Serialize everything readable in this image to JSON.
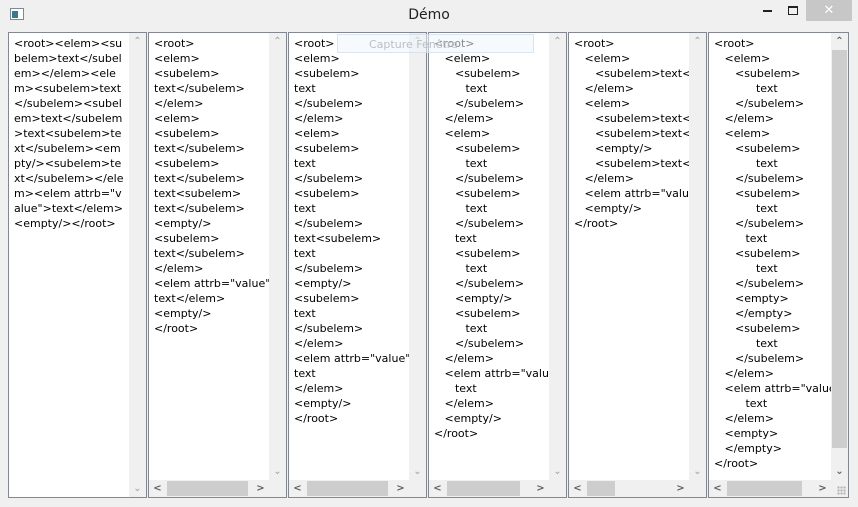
{
  "window": {
    "title": "Démo",
    "minimize_icon": "minimize-icon",
    "maximize_icon": "maximize-icon",
    "close_icon": "close-icon",
    "close_glyph": "✕"
  },
  "tooltip": {
    "text": "Capture Fenêtre"
  },
  "panels": [
    {
      "wrap": true,
      "text": "<root><elem><subelem>text</subelem></elem><elem><subelem>text</subelem><subelem>text</subelem>text<subelem>text</subelem><empty/><subelem>text</subelem></elem><elem attrb=\"value\">text</elem><empty/></root>"
    },
    {
      "wrap": false,
      "text": "<root>\n<elem>\n<subelem>\ntext</subelem>\n</elem>\n<elem>\n<subelem>\ntext</subelem>\n<subelem>\ntext</subelem>\ntext<subelem>\ntext</subelem>\n<empty/>\n<subelem>\ntext</subelem>\n</elem>\n<elem attrb=\"value\">\ntext</elem>\n<empty/>\n</root>"
    },
    {
      "wrap": false,
      "text": "<root>\n<elem>\n<subelem>\ntext\n</subelem>\n</elem>\n<elem>\n<subelem>\ntext\n</subelem>\n<subelem>\ntext\n</subelem>\ntext<subelem>\ntext\n</subelem>\n<empty/>\n<subelem>\ntext\n</subelem>\n</elem>\n<elem attrb=\"value\">\ntext\n</elem>\n<empty/>\n</root>"
    },
    {
      "wrap": false,
      "text": "<root>\n   <elem>\n      <subelem>\n         text\n      </subelem>\n   </elem>\n   <elem>\n      <subelem>\n         text\n      </subelem>\n      <subelem>\n         text\n      </subelem>\n      text\n      <subelem>\n         text\n      </subelem>\n      <empty/>\n      <subelem>\n         text\n      </subelem>\n   </elem>\n   <elem attrb=\"value\">\n      text\n   </elem>\n   <empty/>\n</root>"
    },
    {
      "wrap": false,
      "text": "<root>\n   <elem>\n      <subelem>text</subelem>\n   </elem>\n   <elem>\n      <subelem>text</subelem>\n      <subelem>text</subelem>\n      <empty/>\n      <subelem>text</subelem>\n   </elem>\n   <elem attrb=\"value\">text</elem>\n   <empty/>\n</root>"
    },
    {
      "wrap": false,
      "text": "<root>\n   <elem>\n      <subelem>\n            text\n      </subelem>\n   </elem>\n   <elem>\n      <subelem>\n            text\n      </subelem>\n      <subelem>\n            text\n      </subelem>\n         text\n      <subelem>\n            text\n      </subelem>\n      <empty>\n      </empty>\n      <subelem>\n            text\n      </subelem>\n   </elem>\n   <elem attrb=\"value\">\n         text\n   </elem>\n   <empty>\n   </empty>\n</root>"
    }
  ],
  "scrollbars": {
    "up_glyph": "⌃",
    "down_glyph": "⌄",
    "left_glyph": "<",
    "right_glyph": ">"
  }
}
